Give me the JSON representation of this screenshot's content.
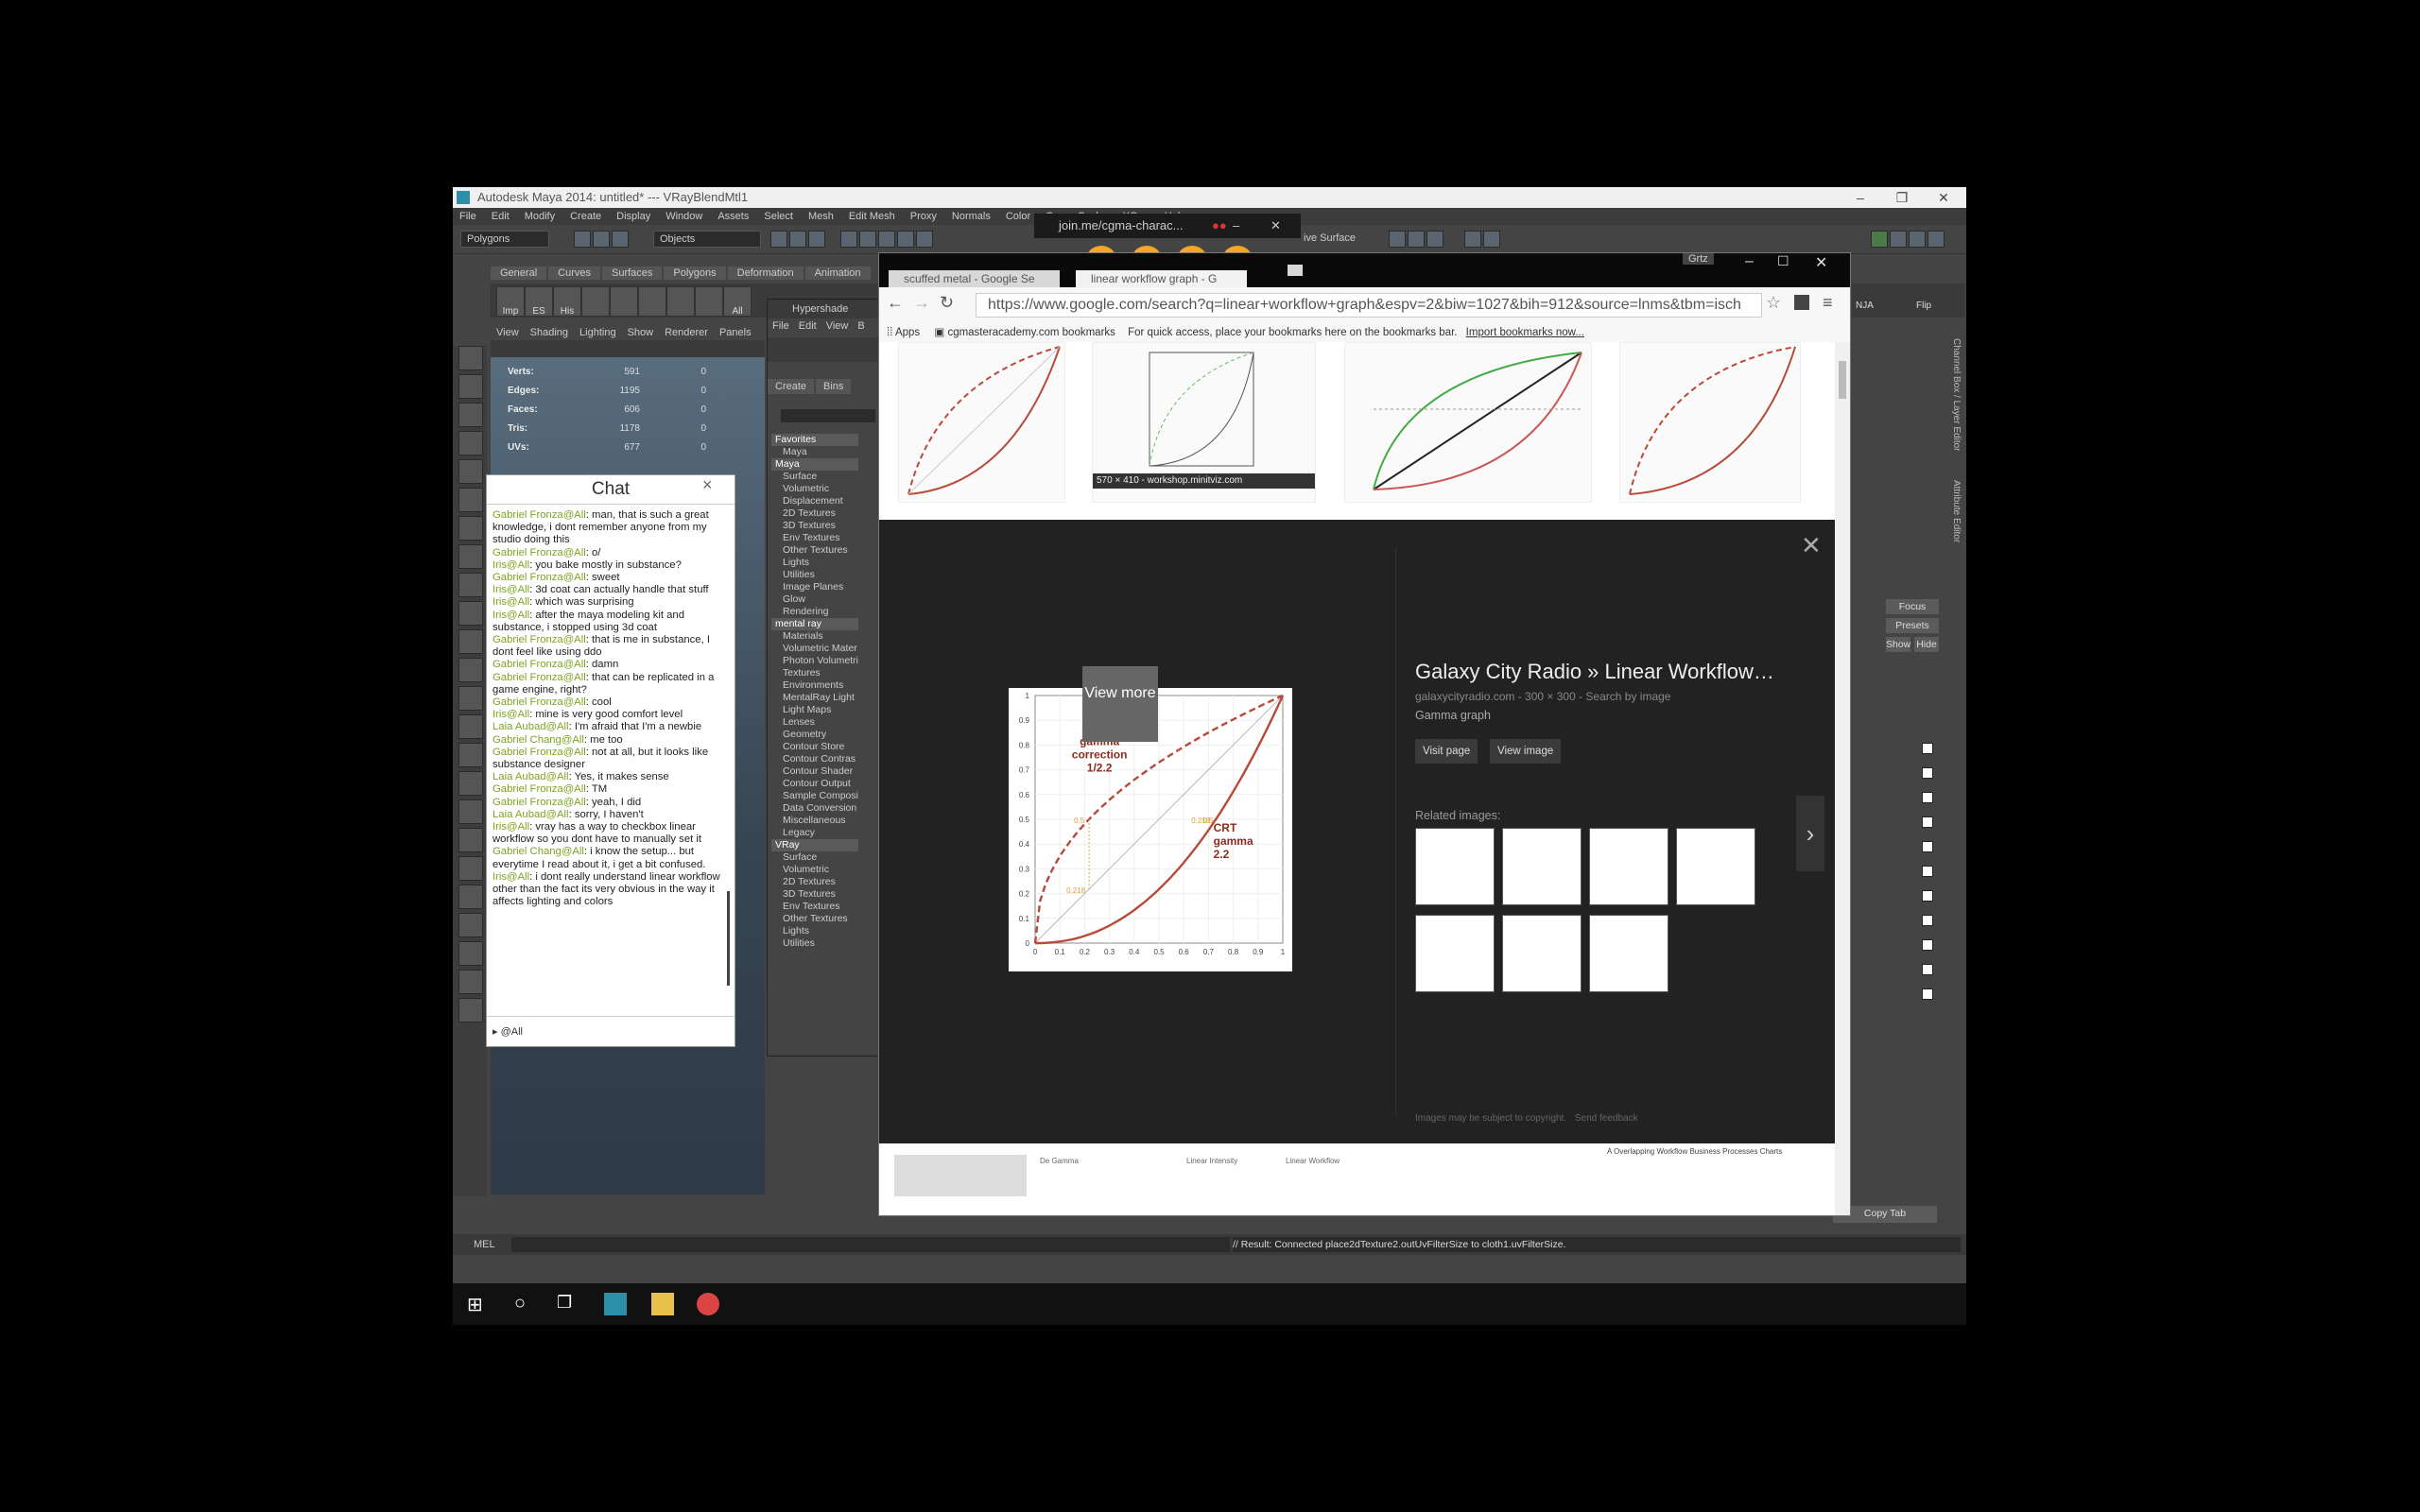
{
  "maya": {
    "title": "Autodesk Maya 2014: untitled*   ---   VRayBlendMtl1",
    "menu": [
      "File",
      "Edit",
      "Modify",
      "Create",
      "Display",
      "Window",
      "Assets",
      "Select",
      "Mesh",
      "Edit Mesh",
      "Proxy",
      "Normals",
      "Color",
      "Cre",
      "Cache",
      "XGen",
      "Help"
    ],
    "mode_select": "Polygons",
    "objects_select": "Objects",
    "live_surface": "ive Surface",
    "shelf_tabs": [
      "General",
      "Curves",
      "Surfaces",
      "Polygons",
      "Deformation",
      "Animation"
    ],
    "shelf_items": [
      "Imp",
      "ES",
      "His",
      "",
      "",
      "",
      "",
      "",
      "All"
    ],
    "viewport_menu": [
      "View",
      "Shading",
      "Lighting",
      "Show",
      "Renderer",
      "Panels"
    ],
    "hud": [
      {
        "label": "Verts:",
        "v1": "591",
        "v2": "0",
        "v3": "0"
      },
      {
        "label": "Edges:",
        "v1": "1195",
        "v2": "0",
        "v3": "0"
      },
      {
        "label": "Faces:",
        "v1": "606",
        "v2": "0",
        "v3": "0"
      },
      {
        "label": "Tris:",
        "v1": "1178",
        "v2": "0",
        "v3": "0"
      },
      {
        "label": "UVs:",
        "v1": "677",
        "v2": "0",
        "v3": "0"
      }
    ],
    "cmd_label": "MEL",
    "result": "// Result: Connected place2dTexture2.outUvFilterSize to cloth1.uvFilterSize.",
    "right_labels": {
      "focus": "Focus",
      "presets": "Presets",
      "show": "Show",
      "hide": "Hide",
      "copy_tab": "Copy Tab",
      "nja": "NJA",
      "flip": "Flip",
      "channel_box": "Channel Box / Layer Editor",
      "attribute_editor": "Attribute Editor"
    }
  },
  "hypershade": {
    "title": "Hypershade",
    "menu": [
      "File",
      "Edit",
      "View",
      "B"
    ],
    "tabs": [
      "Create",
      "Bins"
    ],
    "tree": [
      {
        "t": "Favorites",
        "h": true
      },
      {
        "t": "Maya",
        "h": false
      },
      {
        "t": "Maya",
        "h": true
      },
      {
        "t": "Surface",
        "h": false
      },
      {
        "t": "Volumetric",
        "h": false
      },
      {
        "t": "Displacement",
        "h": false
      },
      {
        "t": "2D Textures",
        "h": false
      },
      {
        "t": "3D Textures",
        "h": false
      },
      {
        "t": "Env Textures",
        "h": false
      },
      {
        "t": "Other Textures",
        "h": false
      },
      {
        "t": "Lights",
        "h": false
      },
      {
        "t": "Utilities",
        "h": false
      },
      {
        "t": "Image Planes",
        "h": false
      },
      {
        "t": "Glow",
        "h": false
      },
      {
        "t": "Rendering",
        "h": false
      },
      {
        "t": "mental ray",
        "h": true
      },
      {
        "t": "Materials",
        "h": false
      },
      {
        "t": "Volumetric Mater",
        "h": false
      },
      {
        "t": "Photon Volumetri",
        "h": false
      },
      {
        "t": "Textures",
        "h": false
      },
      {
        "t": "Environments",
        "h": false
      },
      {
        "t": "MentalRay Light",
        "h": false
      },
      {
        "t": "Light Maps",
        "h": false
      },
      {
        "t": "Lenses",
        "h": false
      },
      {
        "t": "Geometry",
        "h": false
      },
      {
        "t": "Contour Store",
        "h": false
      },
      {
        "t": "Contour Contras",
        "h": false
      },
      {
        "t": "Contour Shader",
        "h": false
      },
      {
        "t": "Contour Output",
        "h": false
      },
      {
        "t": "Sample Composi",
        "h": false
      },
      {
        "t": "Data Conversion",
        "h": false
      },
      {
        "t": "Miscellaneous",
        "h": false
      },
      {
        "t": "Legacy",
        "h": false
      },
      {
        "t": "VRay",
        "h": true
      },
      {
        "t": "Surface",
        "h": false
      },
      {
        "t": "Volumetric",
        "h": false
      },
      {
        "t": "2D Textures",
        "h": false
      },
      {
        "t": "3D Textures",
        "h": false
      },
      {
        "t": "Env Textures",
        "h": false
      },
      {
        "t": "Other Textures",
        "h": false
      },
      {
        "t": "Lights",
        "h": false
      },
      {
        "t": "Utilities",
        "h": false
      }
    ]
  },
  "chat": {
    "title": "Chat",
    "close": "×",
    "messages": [
      {
        "n": "Gabriel Fronza@All",
        "m": ": man, that is such a great knowledge, i dont remember anyone from my studio doing this"
      },
      {
        "n": "Gabriel Fronza@All",
        "m": ": o/"
      },
      {
        "n": "Iris@All",
        "m": ": you bake mostly in substance?"
      },
      {
        "n": "Gabriel Fronza@All",
        "m": ": sweet"
      },
      {
        "n": "Iris@All",
        "m": ": 3d coat can actually handle that stuff"
      },
      {
        "n": "Iris@All",
        "m": ": which was surprising"
      },
      {
        "n": "Iris@All",
        "m": ": after the maya modeling kit and substance, i stopped using 3d coat"
      },
      {
        "n": "Gabriel Fronza@All",
        "m": ": that is me in substance, I dont feel like using ddo"
      },
      {
        "n": "Gabriel Fronza@All",
        "m": ": damn"
      },
      {
        "n": "Gabriel Fronza@All",
        "m": ": that can be replicated in a game engine, right?"
      },
      {
        "n": "Gabriel Fronza@All",
        "m": ": cool"
      },
      {
        "n": "Iris@All",
        "m": ": mine is very good comfort level"
      },
      {
        "n": "Laia Aubad@All",
        "m": ": I'm afraid that I'm a newbie"
      },
      {
        "n": "Gabriel Chang@All",
        "m": ": me too"
      },
      {
        "n": "Gabriel Fronza@All",
        "m": ": not at all, but it looks like substance designer"
      },
      {
        "n": "Laia Aubad@All",
        "m": ": Yes, it makes sense"
      },
      {
        "n": "Gabriel Fronza@All",
        "m": ": TM"
      },
      {
        "n": "Gabriel Fronza@All",
        "m": ": yeah, I did"
      },
      {
        "n": "Laia Aubad@All",
        "m": ": sorry, I haven't"
      },
      {
        "n": "Iris@All",
        "m": ": vray has a way to checkbox linear workflow so you dont have to manually set it"
      },
      {
        "n": "Gabriel Chang@All",
        "m": ": i know the setup... but everytime I read about it, i get a bit confused."
      },
      {
        "n": "Iris@All",
        "m": ": i dont really understand linear workflow other than the fact its very obvious in the way it affects lighting and colors"
      }
    ],
    "recipient": "@All"
  },
  "joinme": {
    "label": "join.me/cgma-charac..."
  },
  "chrome": {
    "tabs": [
      "scuffed metal - Google Se",
      "linear workflow graph - G"
    ],
    "profile": "Grtz",
    "url": "https://www.google.com/search?q=linear+workflow+graph&espv=2&biw=1027&bih=912&source=lnms&tbm=isch",
    "bookmarks": {
      "apps": "Apps",
      "item": "cgmasteracademy.com bookmarks",
      "hint": "For quick access, place your bookmarks here on the bookmarks bar.",
      "import": "Import bookmarks now..."
    },
    "hover_caption": "570 × 410 - workshop.minitviz.com",
    "preview": {
      "title": "Galaxy City Radio » Linear Workflow…",
      "source": "galaxycityradio.com - 300 × 300 - Search by image",
      "desc": "Gamma graph",
      "visit": "Visit page",
      "view": "View image",
      "related": "Related images:",
      "view_more": "View more",
      "copyright": "Images may be subject to copyright.",
      "feedback": "Send feedback"
    },
    "graph": {
      "label_gamma": "gamma correction 1/2.2",
      "label_crt": "CRT gamma 2.2",
      "y_ticks": [
        "0",
        "0.1",
        "0.2",
        "0.3",
        "0.4",
        "0.5",
        "0.6",
        "0.7",
        "0.8",
        "0.9",
        "1"
      ],
      "x_ticks": [
        "0",
        "0.1",
        "0.2",
        "0.3",
        "0.4",
        "0.5",
        "0.6",
        "0.7",
        "0.8",
        "0.9",
        "1"
      ],
      "ann_05a": "0.5",
      "ann_05b": "0.5",
      "ann_218a": "0.218",
      "ann_218b": "0.218"
    },
    "bottom_strip": [
      "De Gamma",
      "Linear Intensity",
      "Linear Workflow",
      "A Overlapping Workflow Business Processes Charts"
    ]
  },
  "colors": {
    "accent_orange": "#f5a623",
    "chat_name": "#7fa31f",
    "graph_red": "#b84a3a"
  }
}
